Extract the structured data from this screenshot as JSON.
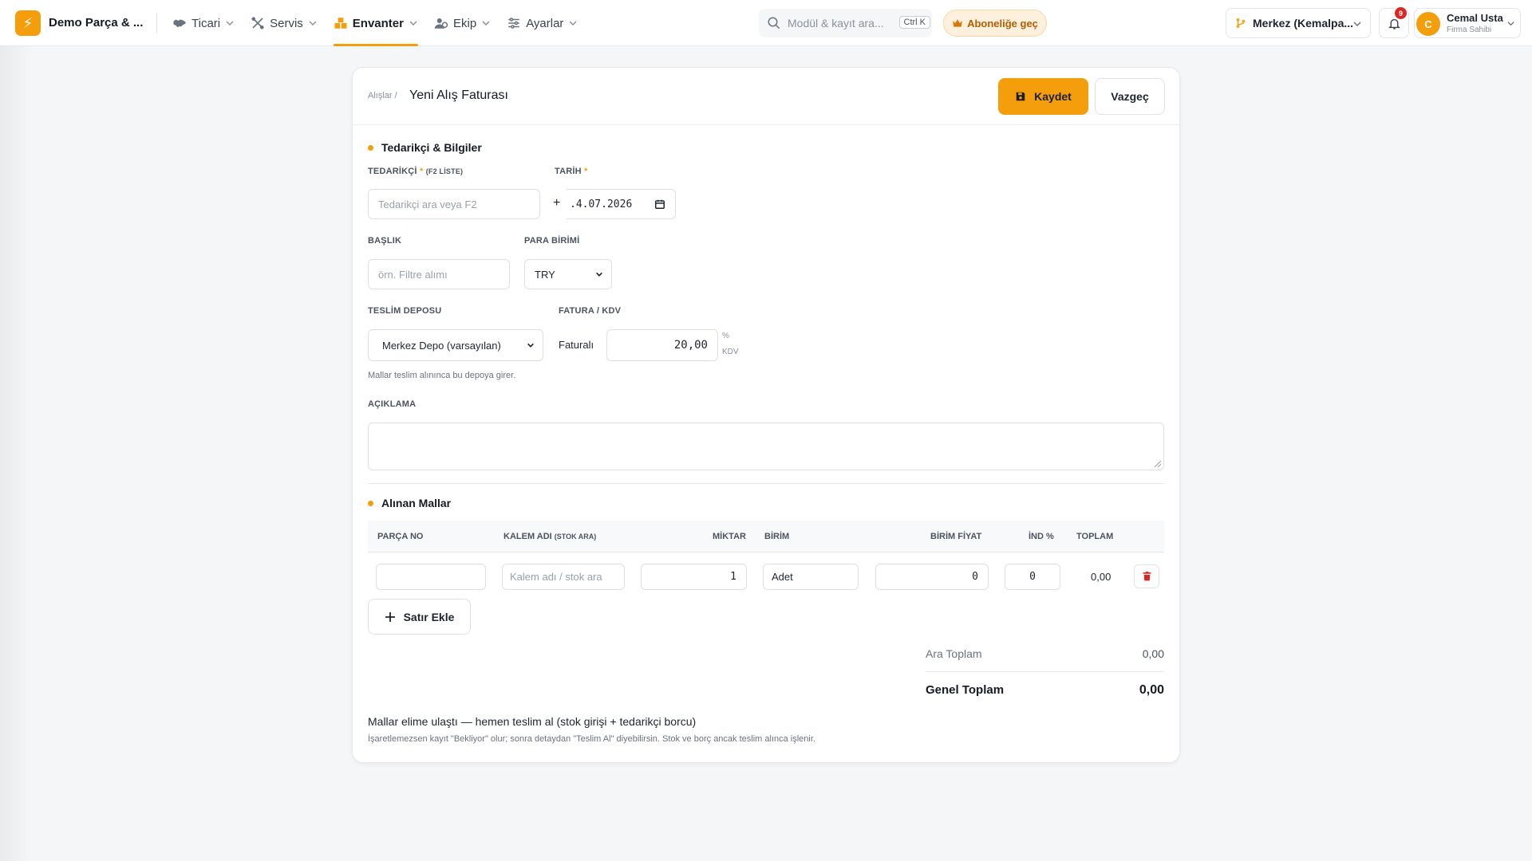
{
  "app": {
    "brand": "Demo Parça & ..."
  },
  "nav": [
    {
      "label": "Ticari",
      "icon": "handshake-icon"
    },
    {
      "label": "Servis",
      "icon": "tools-icon"
    },
    {
      "label": "Envanter",
      "icon": "boxes-icon",
      "active": true
    },
    {
      "label": "Ekip",
      "icon": "users-icon"
    },
    {
      "label": "Ayarlar",
      "icon": "sliders-icon"
    }
  ],
  "search": {
    "placeholder": "Modül & kayıt ara...",
    "shortcut": "Ctrl K"
  },
  "upgrade": {
    "label": "Aboneliğe geç"
  },
  "branch": {
    "label": "Merkez (Kemalpa..."
  },
  "notifications": {
    "count": "9"
  },
  "user": {
    "initial": "C",
    "name": "Cemal Usta",
    "role": "Firma Sahibi"
  },
  "page": {
    "breadcrumb": "Alışlar /",
    "title": "Yeni Alış Faturası",
    "save_label": "Kaydet",
    "cancel_label": "Vazgeç"
  },
  "supplier_section": {
    "title": "Tedarikçi & Bilgiler",
    "supplier_label": "TEDARİKÇİ",
    "supplier_sub": "(F2 LİSTE)",
    "supplier_placeholder": "Tedarikçi ara veya F2",
    "date_label": "TARİH",
    "date_value": ".4.07.2026",
    "title_label": "BAŞLIK",
    "title_placeholder": "örn. Filtre alımı",
    "currency_label": "PARA BİRİMİ",
    "currency_value": "TRY",
    "warehouse_label": "TESLİM DEPOSU",
    "warehouse_value": "Merkez Depo (varsayılan)",
    "warehouse_help": "Mallar teslim alınınca bu depoya girer.",
    "invoice_label": "FATURA / KDV",
    "invoice_type": "Faturalı",
    "vat_value": "20,00",
    "vat_unit_1": "%",
    "vat_unit_2": "KDV",
    "desc_label": "AÇIKLAMA"
  },
  "items_section": {
    "title": "Alınan Mallar",
    "columns": {
      "part_no": "PARÇA NO",
      "item_name": "KALEM ADI",
      "item_name_sub": "(STOK ARA)",
      "qty": "MİKTAR",
      "unit": "BİRİM",
      "unit_price": "BİRİM FİYAT",
      "discount": "İND %",
      "total": "TOPLAM"
    },
    "rows": [
      {
        "part_no": "",
        "item_placeholder": "Kalem adı / stok ara",
        "qty": "1",
        "unit": "Adet",
        "unit_price": "0",
        "discount": "0",
        "total": "0,00"
      }
    ],
    "add_row_label": "Satır Ekle"
  },
  "totals": {
    "subtotal_label": "Ara Toplam",
    "subtotal_value": "0,00",
    "grand_label": "Genel Toplam",
    "grand_value": "0,00"
  },
  "receive": {
    "label": "Mallar elime ulaştı — hemen teslim al (stok girişi + tedarikçi borcu)",
    "help": "İşaretlemezsen kayıt \"Bekliyor\" olur; sonra detaydan \"Teslim Al\" diyebilirsin. Stok ve borç ancak teslim alınca işlenir."
  },
  "colors": {
    "accent": "#f59e0b",
    "danger": "#dc2626"
  }
}
